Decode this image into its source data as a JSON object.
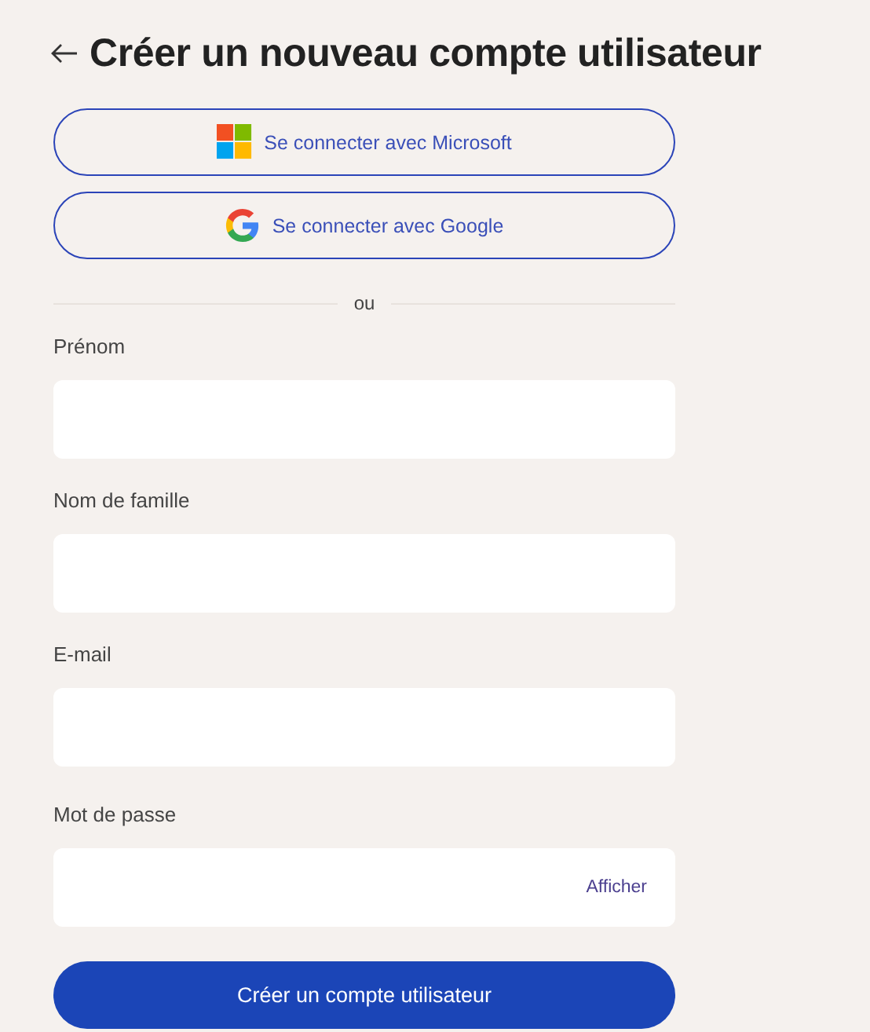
{
  "header": {
    "title": "Créer un nouveau compte utilisateur"
  },
  "sso_buttons": [
    {
      "kind": "microsoft",
      "label": "Se connecter avec Microsoft"
    },
    {
      "kind": "google",
      "label": "Se connecter avec Google"
    }
  ],
  "divider": {
    "label": "ou"
  },
  "fields": [
    {
      "label": "Prénom",
      "kind": "text"
    },
    {
      "label": "Nom de famille",
      "kind": "text"
    },
    {
      "label": "E-mail",
      "kind": "email"
    },
    {
      "label": "Mot de passe",
      "kind": "password",
      "reveal": "Afficher"
    }
  ],
  "submit": {
    "label": "Créer un compte utilisateur"
  }
}
